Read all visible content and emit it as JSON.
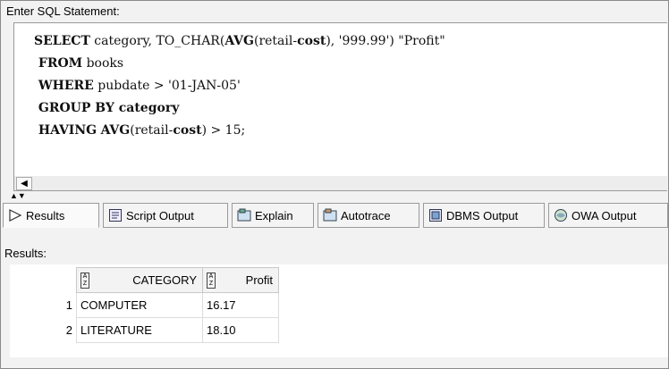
{
  "editor": {
    "label": "Enter SQL Statement:",
    "lines": [
      [
        {
          "t": "SELECT",
          "kw": true
        },
        {
          "t": " category, ",
          "kw": false
        },
        {
          "t": "TO_CHAR(",
          "kw": false
        },
        {
          "t": "AVG",
          "kw": true
        },
        {
          "t": "(retail-",
          "kw": false
        },
        {
          "t": "cost",
          "kw": true
        },
        {
          "t": "), '999.99') \"Profit\"",
          "kw": false
        }
      ],
      [
        {
          "t": " FROM",
          "kw": true
        },
        {
          "t": " books",
          "kw": false
        }
      ],
      [
        {
          "t": " WHERE",
          "kw": true
        },
        {
          "t": " pubdate > '01-JAN-05'",
          "kw": false
        }
      ],
      [
        {
          "t": " GROUP BY category",
          "kw": true
        }
      ],
      [
        {
          "t": " HAVING",
          "kw": true
        },
        {
          "t": " ",
          "kw": false
        },
        {
          "t": "AVG",
          "kw": true
        },
        {
          "t": "(retail-",
          "kw": false
        },
        {
          "t": "cost",
          "kw": true
        },
        {
          "t": ") > 15;",
          "kw": false
        }
      ]
    ]
  },
  "tabs": [
    {
      "label": "Results",
      "icon": "play-icon"
    },
    {
      "label": "Script Output",
      "icon": "script-icon"
    },
    {
      "label": "Explain",
      "icon": "explain-icon"
    },
    {
      "label": "Autotrace",
      "icon": "autotrace-icon"
    },
    {
      "label": "DBMS Output",
      "icon": "dbms-icon"
    },
    {
      "label": "OWA Output",
      "icon": "owa-icon"
    }
  ],
  "results": {
    "label": "Results:",
    "columns": [
      "CATEGORY",
      "Profit"
    ],
    "rows": [
      {
        "num": "1",
        "category": "COMPUTER",
        "profit": "16.17"
      },
      {
        "num": "2",
        "category": "LITERATURE",
        "profit": "18.10"
      }
    ]
  }
}
